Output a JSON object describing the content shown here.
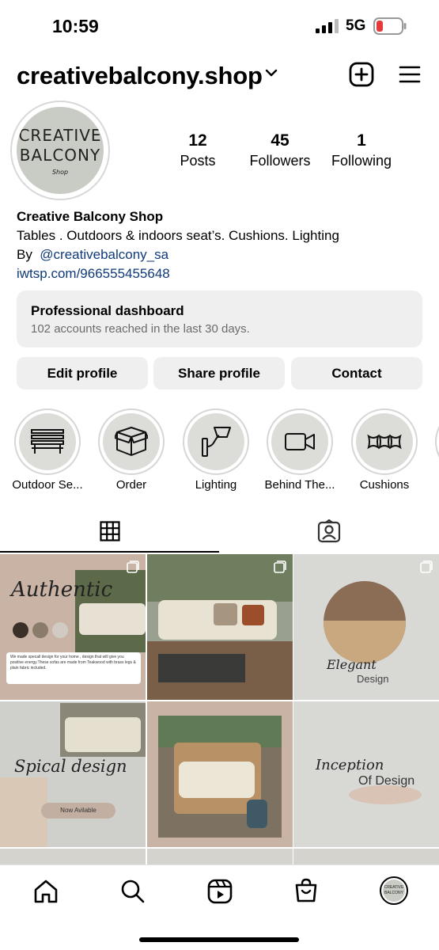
{
  "status": {
    "time": "10:59",
    "network": "5G"
  },
  "header": {
    "username": "creativebalcony.shop"
  },
  "avatar": {
    "logo_line1": "CREATIVE",
    "logo_line2": "BALCONY",
    "logo_line3": "Shop"
  },
  "stats": [
    {
      "value": "12",
      "label": "Posts"
    },
    {
      "value": "45",
      "label": "Followers"
    },
    {
      "value": "1",
      "label": "Following"
    }
  ],
  "bio": {
    "name": "Creative Balcony Shop",
    "description": "Tables . Outdoors & indoors seat’s. Cushions. Lighting",
    "by_prefix": "By",
    "mention": "@creativebalcony_sa",
    "link": "iwtsp.com/966555455648"
  },
  "dashboard": {
    "title": "Professional dashboard",
    "subtitle": "102 accounts reached in the last 30 days."
  },
  "buttons": {
    "edit": "Edit profile",
    "share": "Share profile",
    "contact": "Contact"
  },
  "highlights": [
    {
      "label": "Outdoor Se...",
      "icon": "bench-icon"
    },
    {
      "label": "Order",
      "icon": "box-icon"
    },
    {
      "label": "Lighting",
      "icon": "wall-lamp-icon"
    },
    {
      "label": "Behind The...",
      "icon": "video-camera-icon"
    },
    {
      "label": "Cushions",
      "icon": "cushions-icon"
    }
  ],
  "posts": {
    "p1_title": "Authentic",
    "p1_text": "We made specail design for your home , design that will give you positive energy.These sofas are made from Teakwood with brass legs & plain fabric included.",
    "p3_title": "Elegant",
    "p3_sub": "Design",
    "p4_title": "Spical design",
    "p4_badge": "Now Avilable",
    "p6_title": "Inception",
    "p6_sub": "Of Design"
  },
  "colors": {
    "accent_link": "#0f3a78",
    "button_bg": "#efefef",
    "post_beige": "#c9b3a5"
  }
}
